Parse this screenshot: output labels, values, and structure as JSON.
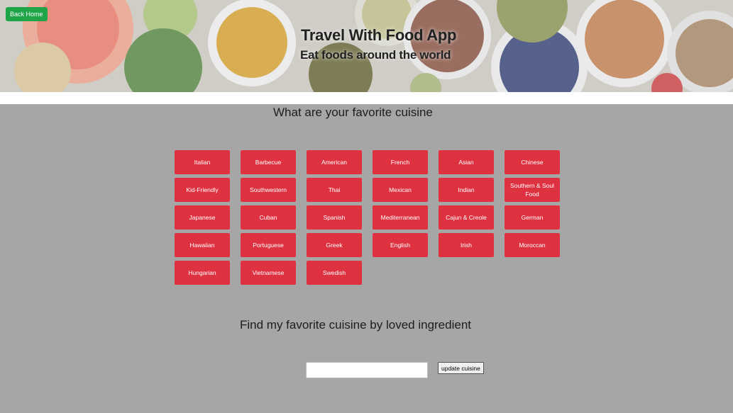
{
  "header": {
    "back_label": "Back Home",
    "title": "Travel With Food App",
    "subtitle": "Eat foods around the world"
  },
  "favorites": {
    "title": "What are your favorite cuisine",
    "cuisines": [
      "Italian",
      "Barbecue",
      "American",
      "French",
      "Asian",
      "Chinese",
      "Kid-Friendly",
      "Southwestern",
      "Thai",
      "Mexican",
      "Indian",
      "Southern & Soul Food",
      "Japanese",
      "Cuban",
      "Spanish",
      "Mediterranean",
      "Cajun & Creole",
      "German",
      "Hawaiian",
      "Portuguese",
      "Greek",
      "English",
      "Irish",
      "Moroccan",
      "Hungarian",
      "Vietnamese",
      "Swedish"
    ],
    "button_color": "#de3241"
  },
  "ingredient": {
    "title": "Find my favorite cuisine by loved ingredient",
    "input_value": "",
    "button_label": "update cuisine"
  },
  "colors": {
    "page_bg": "#a6a6a6",
    "back_button": "#1fa447"
  }
}
